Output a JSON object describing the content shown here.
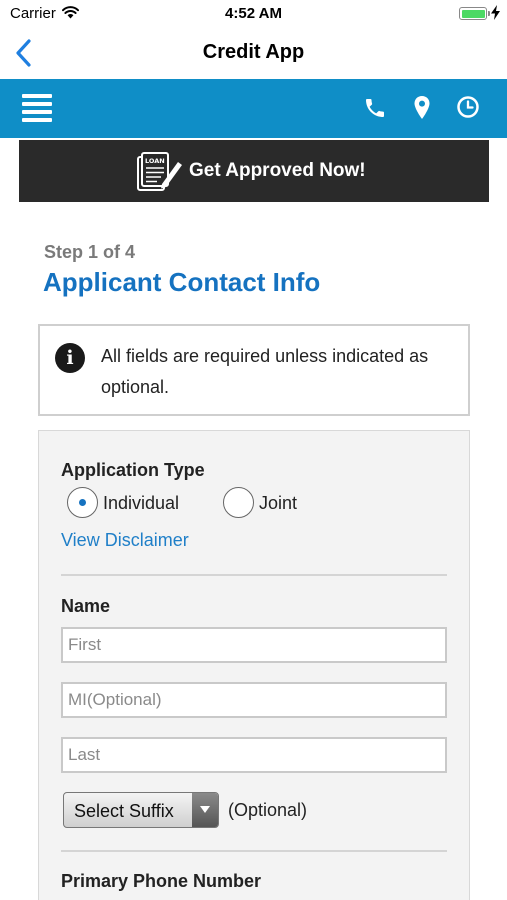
{
  "status_bar": {
    "carrier": "Carrier",
    "time": "4:52 AM",
    "icons": [
      "wifi-icon",
      "battery-icon",
      "charging-bolt-icon"
    ]
  },
  "nav": {
    "title": "Credit App",
    "back_icon": "chevron-left-icon"
  },
  "header": {
    "background_color": "#0f8ec7",
    "icons": [
      "hamburger-menu-icon",
      "phone-icon",
      "location-pin-icon",
      "clock-icon"
    ]
  },
  "banner": {
    "label": "Get Approved Now!",
    "icon_text": "LOAN",
    "icon": "loan-document-icon",
    "background_color": "#2a2a2a"
  },
  "step": {
    "label": "Step 1 of 4",
    "title": "Applicant Contact Info",
    "title_color": "#1572c0"
  },
  "info": {
    "icon": "info-icon",
    "icon_glyph": "i",
    "text": "All fields are required unless indicated as optional."
  },
  "form": {
    "application_type": {
      "label": "Application Type",
      "options": [
        {
          "label": "Individual",
          "selected": true
        },
        {
          "label": "Joint",
          "selected": false
        }
      ],
      "disclaimer_link": "View Disclaimer"
    },
    "name": {
      "label": "Name",
      "first_placeholder": "First",
      "mi_placeholder": "MI(Optional)",
      "last_placeholder": "Last",
      "suffix_select": "Select Suffix",
      "suffix_note": "(Optional)"
    },
    "phone": {
      "label": "Primary Phone Number"
    }
  }
}
